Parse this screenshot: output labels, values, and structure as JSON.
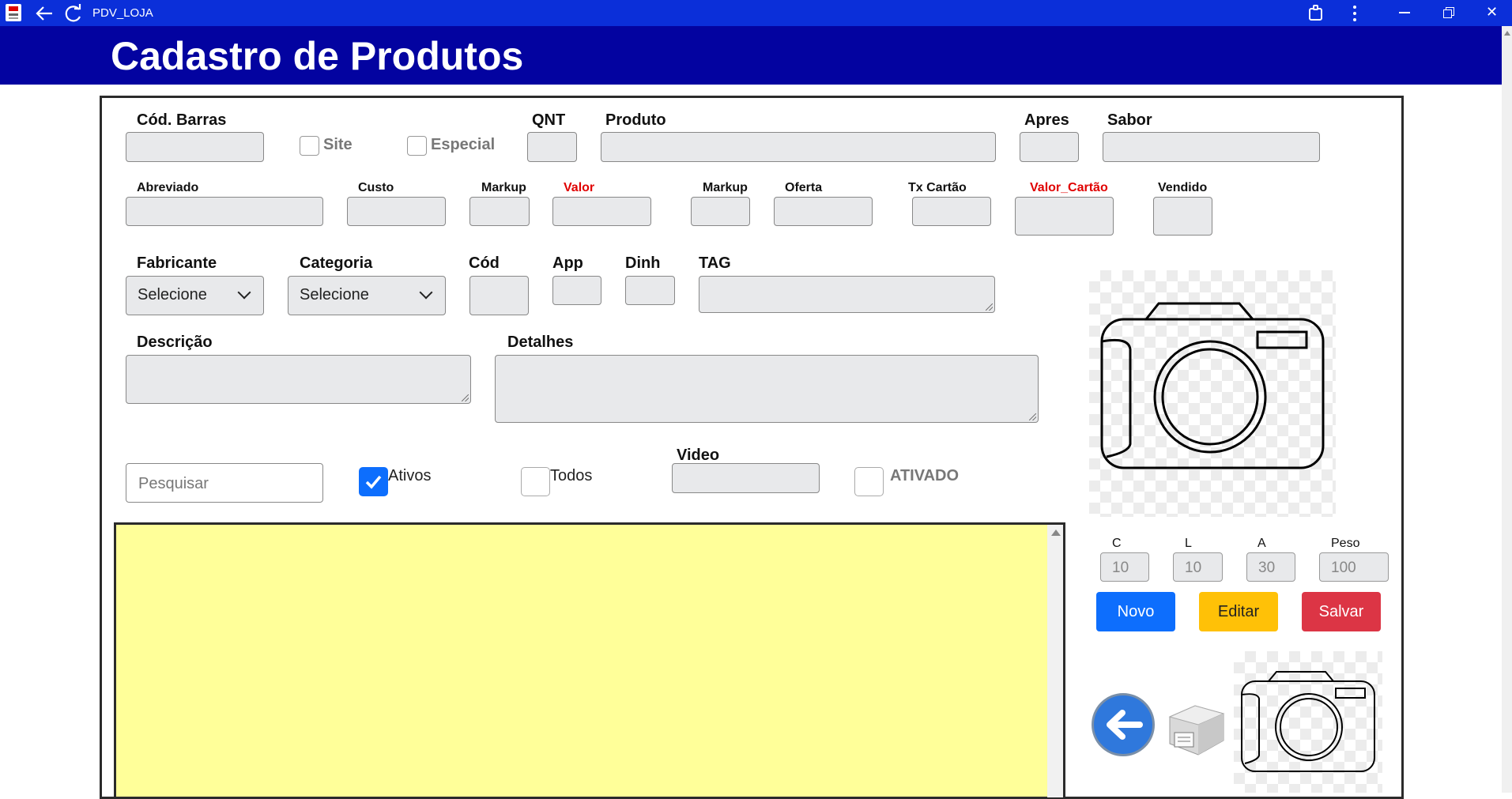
{
  "window": {
    "title": "PDV_LOJA",
    "app_icon": "app-logo-icon",
    "back_icon": "back-arrow-icon",
    "refresh_icon": "refresh-icon",
    "right_icons": [
      "extensions-icon",
      "more-vertical-icon",
      "minimize-icon",
      "restore-icon",
      "close-icon"
    ],
    "close_symbol": "✕"
  },
  "header": {
    "title": "Cadastro de Produtos",
    "bg": "#0303a0"
  },
  "row1": {
    "cod_barras": "Cód. Barras",
    "site": "Site",
    "especial": "Especial",
    "qnt": "QNT",
    "produto": "Produto",
    "apres": "Apres",
    "sabor": "Sabor"
  },
  "row2": {
    "abreviado": "Abreviado",
    "custo": "Custo",
    "markup1": "Markup",
    "valor": "Valor",
    "markup2": "Markup",
    "oferta": "Oferta",
    "tx_cartao": "Tx Cartão",
    "valor_cartao": "Valor_Cartão",
    "vendido": "Vendido"
  },
  "row3": {
    "fabricante": "Fabricante",
    "fabricante_value": "Selecione",
    "categoria": "Categoria",
    "categoria_value": "Selecione",
    "cod": "Cód",
    "app": "App",
    "dinh": "Dinh",
    "tag": "TAG"
  },
  "row4": {
    "descricao": "Descrição",
    "detalhes": "Detalhes"
  },
  "row5": {
    "search_placeholder": "Pesquisar",
    "ativos": "Ativos",
    "todos": "Todos",
    "video": "Video",
    "ativado": "ATIVADO"
  },
  "dims": {
    "labels": [
      "C",
      "L",
      "A",
      "Peso"
    ],
    "values": [
      "10",
      "10",
      "30",
      "100"
    ]
  },
  "buttons": {
    "novo": "Novo",
    "editar": "Editar",
    "salvar": "Salvar",
    "novo_color": "#0d6efd",
    "editar_color": "#ffc107",
    "salvar_color": "#dc3545"
  },
  "images": {
    "main_photo": "camera-placeholder-icon",
    "small_photo": "camera-placeholder-small-icon",
    "back_button": "back-circle-icon",
    "printer": "label-printer-icon"
  },
  "list_area_color": "#ffff99"
}
